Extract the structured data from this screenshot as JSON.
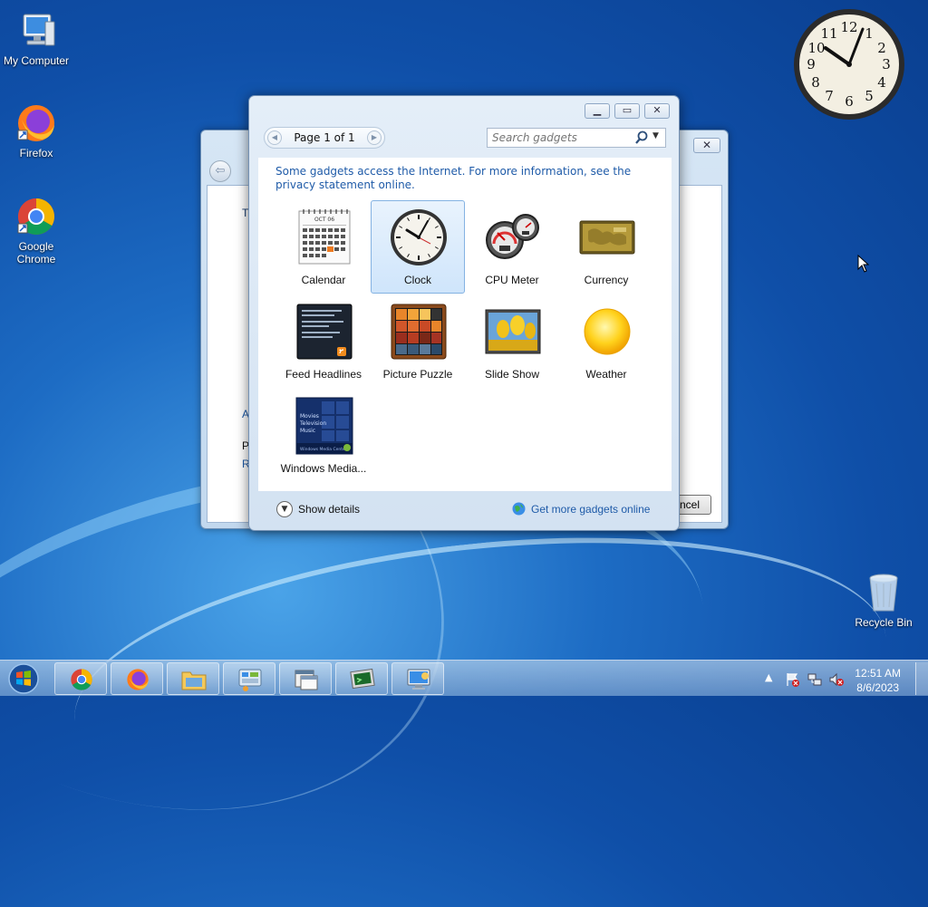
{
  "desktop": {
    "icons": [
      {
        "label": "My Computer"
      },
      {
        "label": "Firefox"
      },
      {
        "label": "Google Chrome"
      },
      {
        "label": "Recycle Bin"
      }
    ]
  },
  "back_window": {
    "cancel_label": "ncel",
    "fragments": [
      "T",
      "A",
      "P",
      "R"
    ]
  },
  "gadget_window": {
    "pager_label": "Page 1 of 1",
    "search_placeholder": "Search gadgets",
    "notice": "Some gadgets access the Internet.  For more information, see the privacy statement online.",
    "gadgets": [
      {
        "name": "Calendar",
        "selected": false
      },
      {
        "name": "Clock",
        "selected": true
      },
      {
        "name": "CPU Meter",
        "selected": false
      },
      {
        "name": "Currency",
        "selected": false
      },
      {
        "name": "Feed Headlines",
        "selected": false
      },
      {
        "name": "Picture Puzzle",
        "selected": false
      },
      {
        "name": "Slide Show",
        "selected": false
      },
      {
        "name": "Weather",
        "selected": false
      },
      {
        "name": "Windows Media...",
        "selected": false
      }
    ],
    "show_details": "Show details",
    "get_more": "Get more gadgets online"
  },
  "calendar_art": {
    "month": "OCT 06"
  },
  "media_art": {
    "lines": [
      "Movies",
      "Television",
      "Music"
    ],
    "footer": "Windows Media Center"
  },
  "taskbar": {
    "buttons": [
      "start-orb",
      "chrome-icon",
      "firefox-icon",
      "file-explorer-icon",
      "control-panel-icon",
      "window-icon",
      "terminal-icon",
      "remote-desktop-icon"
    ]
  },
  "tray": {
    "time": "12:51 AM",
    "date": "8/6/2023"
  },
  "colors": {
    "desktop_blue": "#1d6cc4",
    "link_blue": "#1f5ba8",
    "selection": "#cfe5fb"
  }
}
